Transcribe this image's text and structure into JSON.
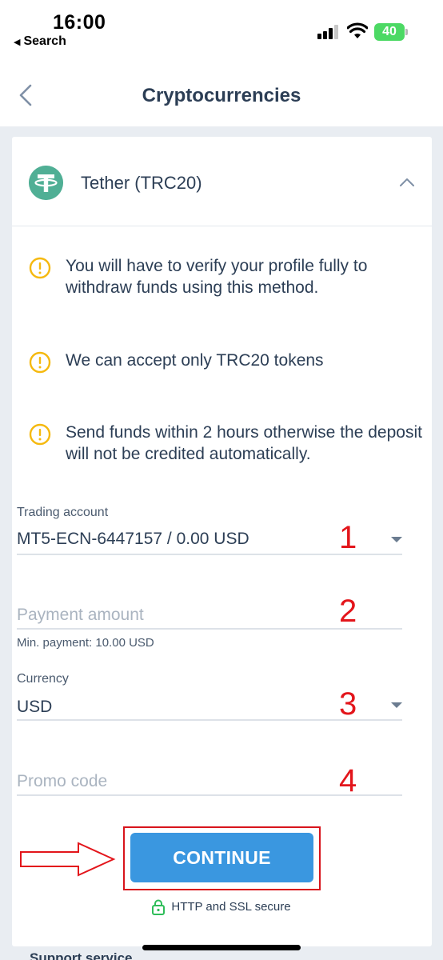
{
  "status_bar": {
    "time": "16:00",
    "back_app": "Search",
    "battery": "40"
  },
  "nav": {
    "title": "Cryptocurrencies"
  },
  "method": {
    "name": "Tether (TRC20)",
    "logo_color": "#50af95"
  },
  "notices": [
    {
      "text": "You will have to verify your profile fully to withdraw funds using this method."
    },
    {
      "text": "We can accept only TRC20 tokens"
    },
    {
      "text": "Send funds within 2 hours otherwise the deposit will not be credited automatically."
    }
  ],
  "form": {
    "trading_account": {
      "label": "Trading account",
      "value": "MT5-ECN-6447157 / 0.00 USD"
    },
    "payment_amount": {
      "placeholder": "Payment amount",
      "hint": "Min. payment: 10.00 USD"
    },
    "currency": {
      "label": "Currency",
      "value": "USD"
    },
    "promo_code": {
      "placeholder": "Promo code"
    }
  },
  "annotations": [
    "1",
    "2",
    "3",
    "4"
  ],
  "continue_label": "CONTINUE",
  "secure_text": "HTTP and SSL secure",
  "support_text": "Support service",
  "colors": {
    "accent": "#3a97e0",
    "warning": "#f5b90f",
    "annotation": "#e3151b",
    "secure_lock": "#2ebd59"
  }
}
